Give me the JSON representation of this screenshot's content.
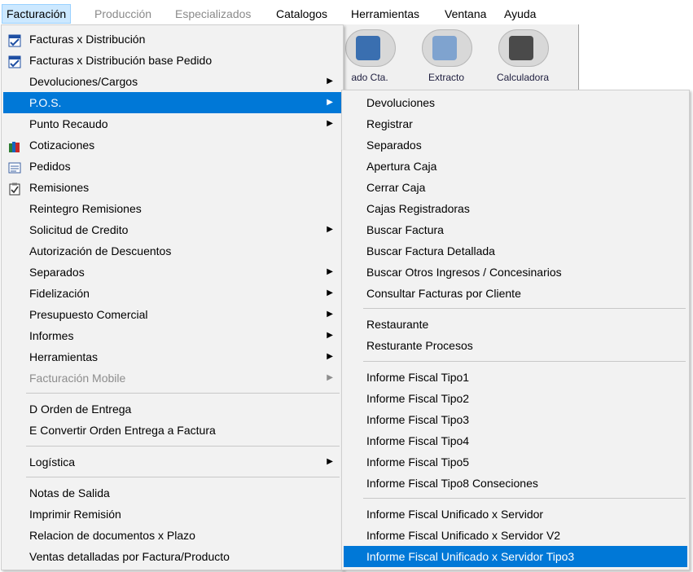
{
  "menubar": {
    "items": [
      {
        "label": "Facturación",
        "state": "active"
      },
      {
        "label": "Producción",
        "state": "disabled"
      },
      {
        "label": "Especializados",
        "state": "disabled"
      },
      {
        "label": "Catalogos",
        "state": "normal"
      },
      {
        "label": "Herramientas",
        "state": "normal"
      },
      {
        "label": "Ventana",
        "state": "normal"
      },
      {
        "label": "Ayuda",
        "state": "normal"
      }
    ]
  },
  "toolbar": {
    "buttons": [
      {
        "label": "ado Cta.",
        "icon": "account-statement-icon"
      },
      {
        "label": "Extracto",
        "icon": "extract-icon"
      },
      {
        "label": "Calculadora",
        "icon": "calculator-icon"
      }
    ]
  },
  "main_menu": {
    "items": [
      {
        "label": "Facturas x Distribución",
        "icon": "invoice-icon"
      },
      {
        "label": "Facturas x Distribución base Pedido",
        "icon": "invoice-icon"
      },
      {
        "label": "Devoluciones/Cargos",
        "submenu": true
      },
      {
        "label": "P.O.S.",
        "submenu": true,
        "highlight": true
      },
      {
        "label": "Punto Recaudo",
        "submenu": true
      },
      {
        "label": "Cotizaciones",
        "icon": "books-icon"
      },
      {
        "label": "Pedidos",
        "icon": "form-icon"
      },
      {
        "label": "Remisiones",
        "icon": "clipboard-check-icon"
      },
      {
        "label": "Reintegro Remisiones"
      },
      {
        "label": "Solicitud de Credito",
        "submenu": true
      },
      {
        "label": "Autorización de Descuentos"
      },
      {
        "label": "Separados",
        "submenu": true
      },
      {
        "label": "Fidelización",
        "submenu": true
      },
      {
        "label": "Presupuesto Comercial",
        "submenu": true
      },
      {
        "label": "Informes",
        "submenu": true
      },
      {
        "label": "Herramientas",
        "submenu": true,
        "mnemonic": "H"
      },
      {
        "label": "Facturación Mobile",
        "submenu": true,
        "disabled": true
      },
      {
        "label": "D Orden de Entrega",
        "mnemonic": "D",
        "group_start": true
      },
      {
        "label": "E Convertir Orden Entrega a Factura",
        "mnemonic": "E"
      },
      {
        "label": "Logística",
        "submenu": true,
        "group_start": true
      },
      {
        "label": "Notas de Salida",
        "group_start": true
      },
      {
        "label": "Imprimir Remisión"
      },
      {
        "label": "Relacion de documentos x Plazo"
      },
      {
        "label": "Ventas detalladas por Factura/Producto"
      }
    ]
  },
  "pos_menu": {
    "items": [
      {
        "label": "Devoluciones"
      },
      {
        "label": "Registrar"
      },
      {
        "label": "Separados"
      },
      {
        "label": "Apertura Caja"
      },
      {
        "label": "Cerrar Caja"
      },
      {
        "label": "Cajas Registradoras"
      },
      {
        "label": "Buscar Factura"
      },
      {
        "label": "Buscar Factura Detallada"
      },
      {
        "label": "Buscar Otros Ingresos / Concesinarios"
      },
      {
        "label": "Consultar Facturas por Cliente"
      },
      {
        "label": "Restaurante",
        "group_start": true
      },
      {
        "label": "Resturante Procesos"
      },
      {
        "label": "Informe Fiscal Tipo1",
        "group_start": true
      },
      {
        "label": "Informe Fiscal Tipo2"
      },
      {
        "label": "Informe Fiscal Tipo3"
      },
      {
        "label": "Informe Fiscal Tipo4"
      },
      {
        "label": "Informe Fiscal Tipo5"
      },
      {
        "label": "Informe Fiscal Tipo8 Conseciones"
      },
      {
        "label": "Informe Fiscal Unificado x Servidor",
        "group_start": true
      },
      {
        "label": "Informe Fiscal Unificado x Servidor V2"
      },
      {
        "label": "Informe Fiscal Unificado x Servidor Tipo3",
        "highlight": true
      }
    ]
  },
  "colors": {
    "highlight": "#0078d7",
    "menu_bg": "#f2f2f2",
    "menubar_active": "#cce8ff"
  }
}
